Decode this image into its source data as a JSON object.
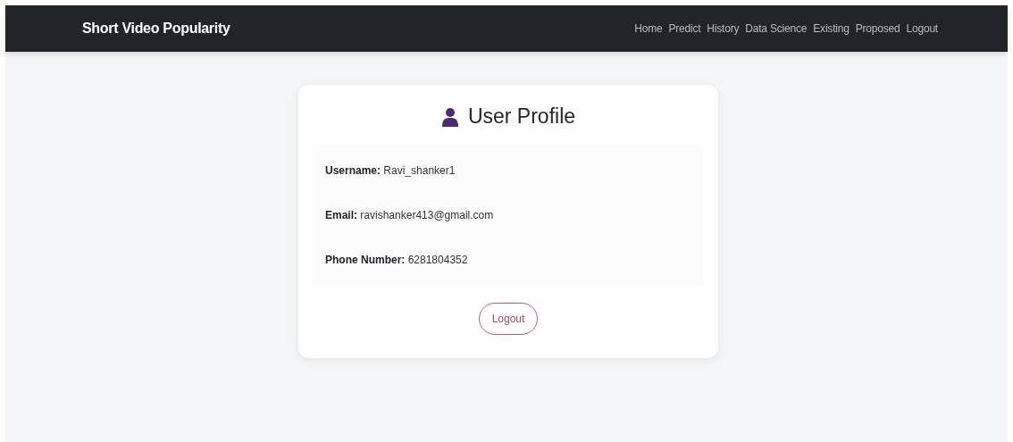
{
  "navbar": {
    "brand": "Short Video Popularity",
    "links": [
      {
        "label": "Home"
      },
      {
        "label": "Predict"
      },
      {
        "label": "History"
      },
      {
        "label": "Data Science"
      },
      {
        "label": "Existing"
      },
      {
        "label": "Proposed"
      },
      {
        "label": "Logout"
      }
    ]
  },
  "profile": {
    "title": "User Profile",
    "fields": [
      {
        "text": "**Username:** Ravi_shanker1"
      },
      {
        "text": "**Email:** ravishanker413@gmail.com"
      },
      {
        "text": "**Phone Number:** 6281804352"
      }
    ],
    "button": "Logout"
  }
}
